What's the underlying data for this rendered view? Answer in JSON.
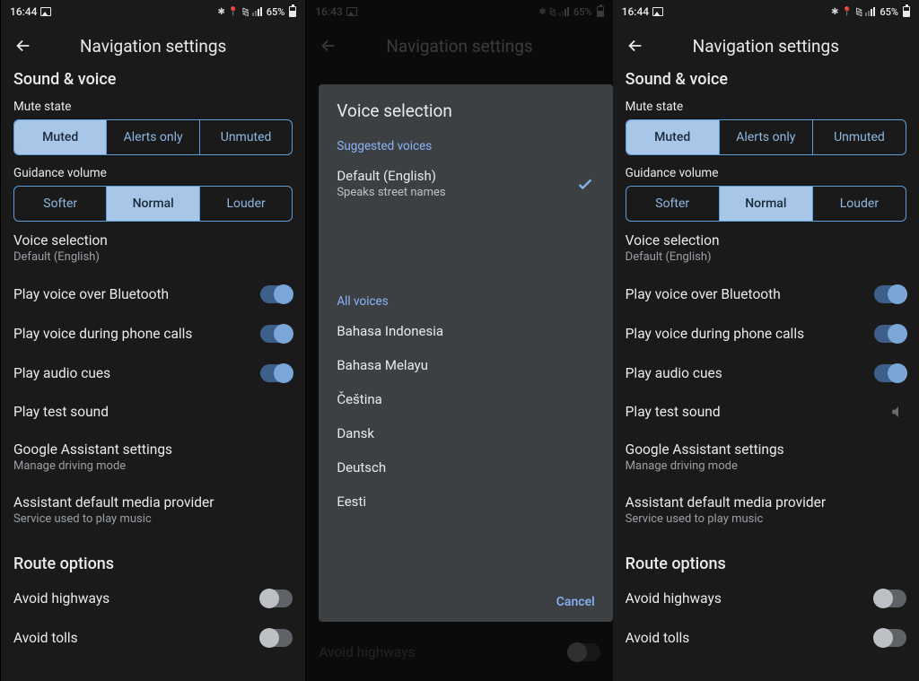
{
  "status": {
    "time_a": "16:44",
    "time_b": "16:43",
    "battery": "65%",
    "icons": [
      "bluetooth",
      "location",
      "wifi",
      "signal"
    ]
  },
  "app": {
    "title": "Navigation settings"
  },
  "sound": {
    "header": "Sound & voice",
    "mute_label": "Mute state",
    "mute_options": [
      "Muted",
      "Alerts only",
      "Unmuted"
    ],
    "volume_label": "Guidance volume",
    "volume_options": [
      "Softer",
      "Normal",
      "Louder"
    ]
  },
  "settings": {
    "voice_selection": {
      "title": "Voice selection",
      "sub": "Default (English)"
    },
    "bluetooth": {
      "title": "Play voice over Bluetooth"
    },
    "phone_calls": {
      "title": "Play voice during phone calls"
    },
    "audio_cues": {
      "title": "Play audio cues"
    },
    "test_sound": {
      "title": "Play test sound"
    },
    "assistant": {
      "title": "Google Assistant settings",
      "sub": "Manage driving mode"
    },
    "media_provider": {
      "title": "Assistant default media provider",
      "sub": "Service used to play music"
    }
  },
  "route": {
    "header": "Route options",
    "highways": "Avoid highways",
    "tolls": "Avoid tolls"
  },
  "dialog": {
    "title": "Voice selection",
    "suggested_header": "Suggested voices",
    "default_title": "Default (English)",
    "default_sub": "Speaks street names",
    "all_header": "All voices",
    "voices": [
      "Bahasa Indonesia",
      "Bahasa Melayu",
      "Čeština",
      "Dansk",
      "Deutsch",
      "Eesti"
    ],
    "cancel": "Cancel"
  }
}
